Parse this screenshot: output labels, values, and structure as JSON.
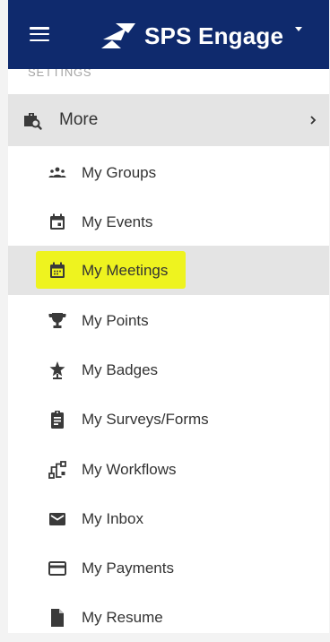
{
  "header": {
    "brand": "SPS Engage",
    "brand_color": "#0f2a6d"
  },
  "sidebar": {
    "section_label": "SETTINGS",
    "more": {
      "label": "More",
      "icon": "briefcase-search-icon"
    },
    "items": [
      {
        "label": "My Groups",
        "icon": "groups-icon"
      },
      {
        "label": "My Events",
        "icon": "calendar-icon"
      },
      {
        "label": "My Meetings",
        "icon": "calendar-meetings-icon",
        "active": true,
        "highlight_color": "#eef31f"
      },
      {
        "label": "My Points",
        "icon": "trophy-icon"
      },
      {
        "label": "My Badges",
        "icon": "badge-star-icon"
      },
      {
        "label": "My Surveys/Forms",
        "icon": "clipboard-icon"
      },
      {
        "label": "My Workflows",
        "icon": "workflow-icon"
      },
      {
        "label": "My Inbox",
        "icon": "mail-icon"
      },
      {
        "label": "My Payments",
        "icon": "credit-card-icon"
      },
      {
        "label": "My Resume",
        "icon": "document-icon"
      }
    ]
  }
}
